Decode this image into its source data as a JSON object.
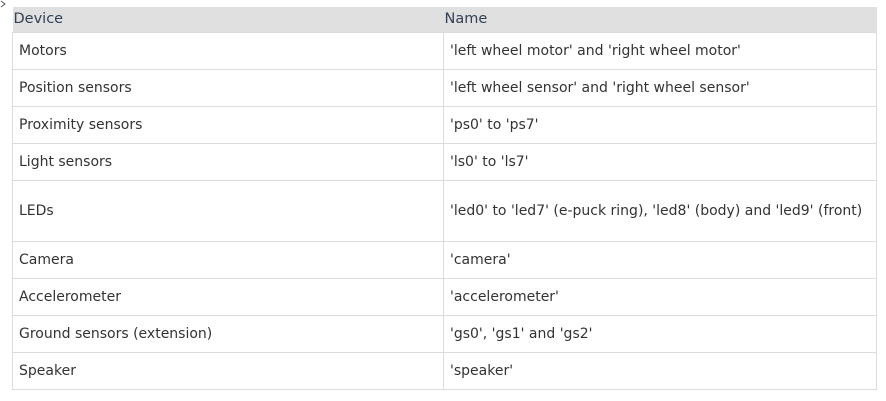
{
  "table": {
    "headers": [
      "Device",
      "Name"
    ],
    "rows": [
      {
        "device": "Motors",
        "name": "'left wheel motor' and 'right wheel motor'"
      },
      {
        "device": "Position sensors",
        "name": "'left wheel sensor' and 'right wheel sensor'"
      },
      {
        "device": "Proximity sensors",
        "name": "'ps0' to 'ps7'"
      },
      {
        "device": "Light sensors",
        "name": "'ls0' to 'ls7'"
      },
      {
        "device": "LEDs",
        "name": "'led0' to 'led7' (e-puck ring), 'led8' (body) and 'led9' (front)"
      },
      {
        "device": "Camera",
        "name": "'camera'"
      },
      {
        "device": "Accelerometer",
        "name": "'accelerometer'"
      },
      {
        "device": "Ground sensors (extension)",
        "name": "'gs0', 'gs1' and 'gs2'"
      },
      {
        "device": "Speaker",
        "name": "'speaker'"
      }
    ]
  }
}
